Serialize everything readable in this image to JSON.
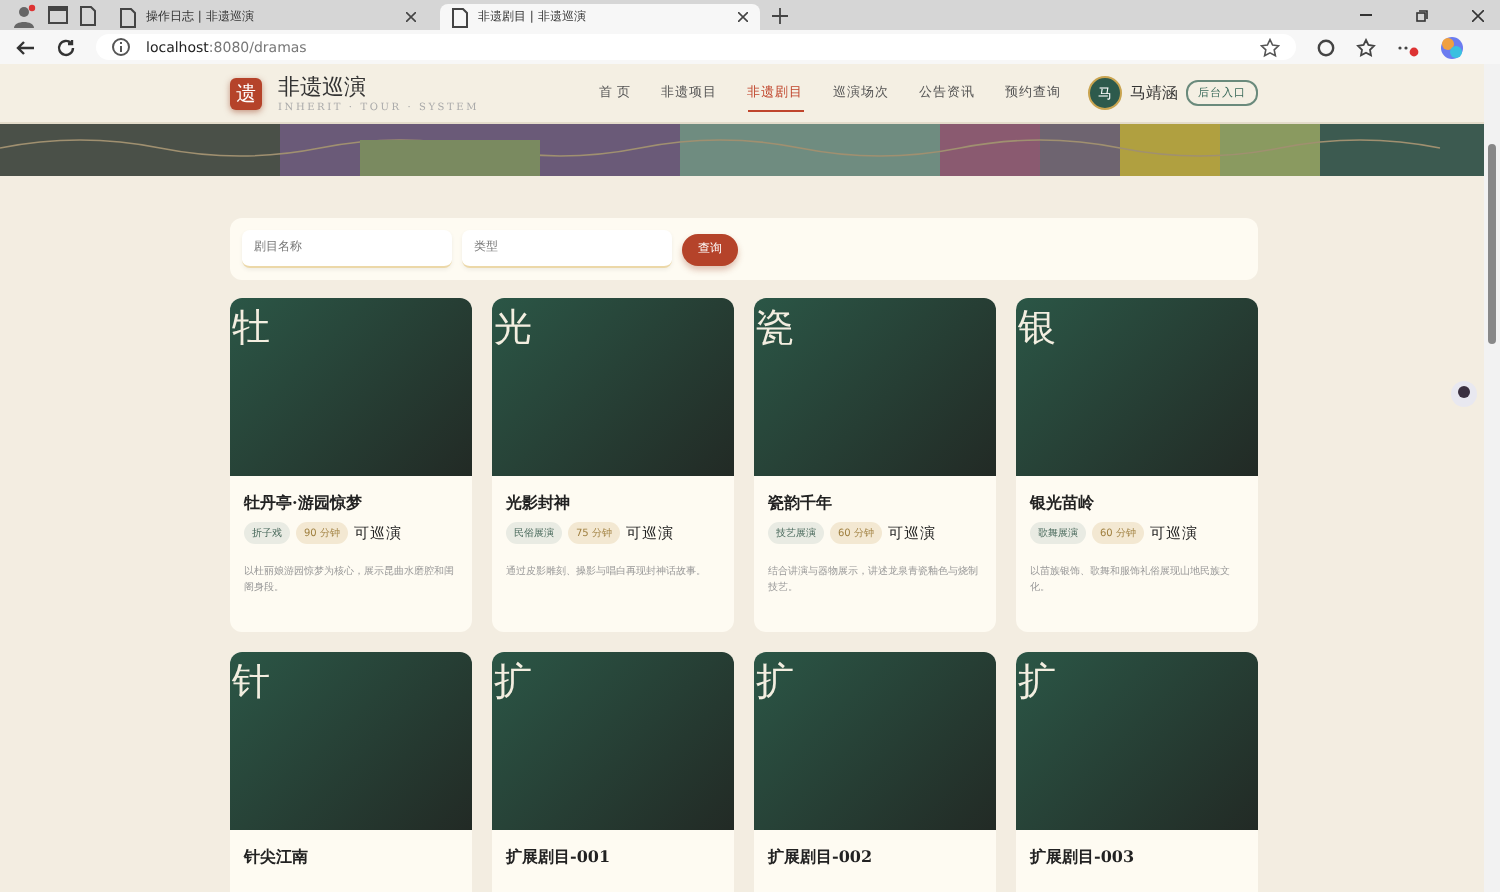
{
  "browser": {
    "tabs": [
      {
        "title": "操作日志 | 非遗巡演",
        "selected": false
      },
      {
        "title": "非遗剧目 | 非遗巡演",
        "selected": true
      }
    ],
    "url_host": "localhost",
    "url_rest": ":8080/dramas"
  },
  "header": {
    "logo": "遗",
    "title": "非遗巡演",
    "subtitle": "INHERIT · TOUR · SYSTEM",
    "nav": [
      {
        "label": "首 页",
        "selected": false
      },
      {
        "label": "非遗项目",
        "selected": false
      },
      {
        "label": "非遗剧目",
        "selected": true
      },
      {
        "label": "巡演场次",
        "selected": false
      },
      {
        "label": "公告资讯",
        "selected": false
      },
      {
        "label": "预约查询",
        "selected": false
      }
    ],
    "user": {
      "avatar": "马",
      "name": "马靖涵"
    },
    "admin_button": "后台入口"
  },
  "search": {
    "name_placeholder": "剧目名称",
    "type_placeholder": "类型",
    "button": "查询"
  },
  "dramas": [
    {
      "cover_char": "牡",
      "title": "牡丹亭·游园惊梦",
      "category": "折子戏",
      "duration": "90 分钟",
      "status": "可巡演",
      "description": "以杜丽娘游园惊梦为核心，展示昆曲水磨腔和闺阁身段。"
    },
    {
      "cover_char": "光",
      "title": "光影封神",
      "category": "民俗展演",
      "duration": "75 分钟",
      "status": "可巡演",
      "description": "通过皮影雕刻、操影与唱白再现封神话故事。"
    },
    {
      "cover_char": "瓷",
      "title": "瓷韵千年",
      "category": "技艺展演",
      "duration": "60 分钟",
      "status": "可巡演",
      "description": "结合讲演与器物展示，讲述龙泉青瓷釉色与烧制技艺。"
    },
    {
      "cover_char": "银",
      "title": "银光苗岭",
      "category": "歌舞展演",
      "duration": "60 分钟",
      "status": "可巡演",
      "description": "以苗族银饰、歌舞和服饰礼俗展现山地民族文化。"
    },
    {
      "cover_char": "针",
      "title": "针尖江南"
    },
    {
      "cover_char": "扩",
      "title": "扩展剧目-001"
    },
    {
      "cover_char": "扩",
      "title": "扩展剧目-002"
    },
    {
      "cover_char": "扩",
      "title": "扩展剧目-003"
    }
  ]
}
